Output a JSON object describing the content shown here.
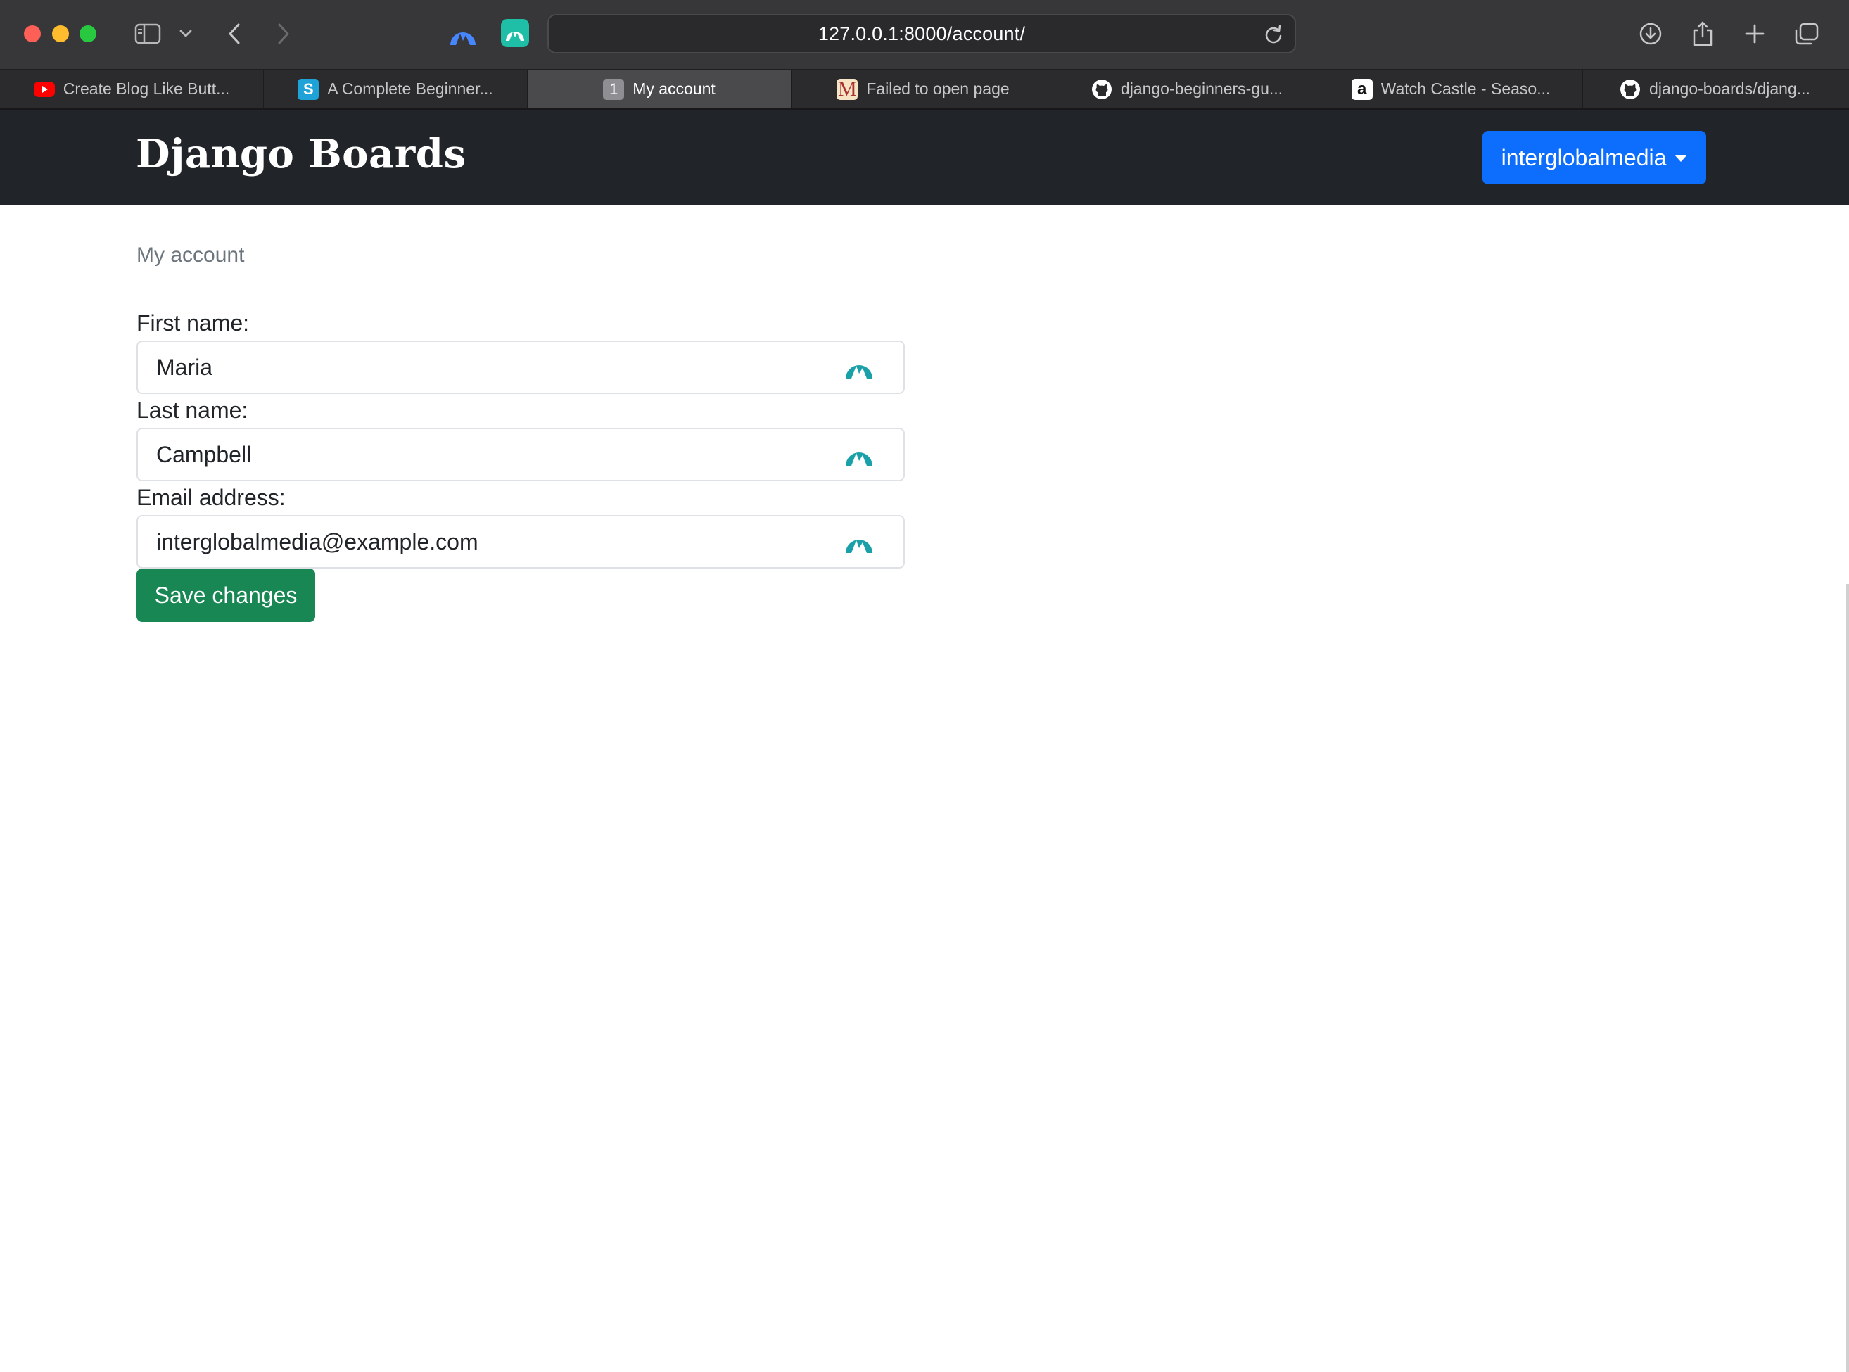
{
  "browser": {
    "url": "127.0.0.1:8000/account/",
    "tabs": [
      {
        "label": "Create Blog Like Butt...",
        "icon": "youtube-icon"
      },
      {
        "label": "A Complete Beginner...",
        "icon": "simple-is-better-icon",
        "glyph": "S"
      },
      {
        "label": "My account",
        "icon": "tab-group-1-icon",
        "glyph": "1",
        "active": true
      },
      {
        "label": "Failed to open page",
        "icon": "medium-icon",
        "glyph": "M"
      },
      {
        "label": "django-beginners-gu...",
        "icon": "github-icon"
      },
      {
        "label": "Watch Castle - Seaso...",
        "icon": "amazon-icon",
        "glyph": "a"
      },
      {
        "label": "django-boards/djang...",
        "icon": "github-icon"
      }
    ]
  },
  "navbar": {
    "brand": "Django Boards",
    "user_menu": "interglobalmedia"
  },
  "page": {
    "heading": "My account"
  },
  "form": {
    "first_name": {
      "label": "First name:",
      "value": "Maria"
    },
    "last_name": {
      "label": "Last name:",
      "value": "Campbell"
    },
    "email": {
      "label": "Email address:",
      "value": "interglobalmedia@example.com"
    },
    "submit_label": "Save changes"
  },
  "colors": {
    "navbar_bg": "#212529",
    "primary": "#0d6efd",
    "success": "#198754",
    "nordpass": "#1aa0a8"
  }
}
